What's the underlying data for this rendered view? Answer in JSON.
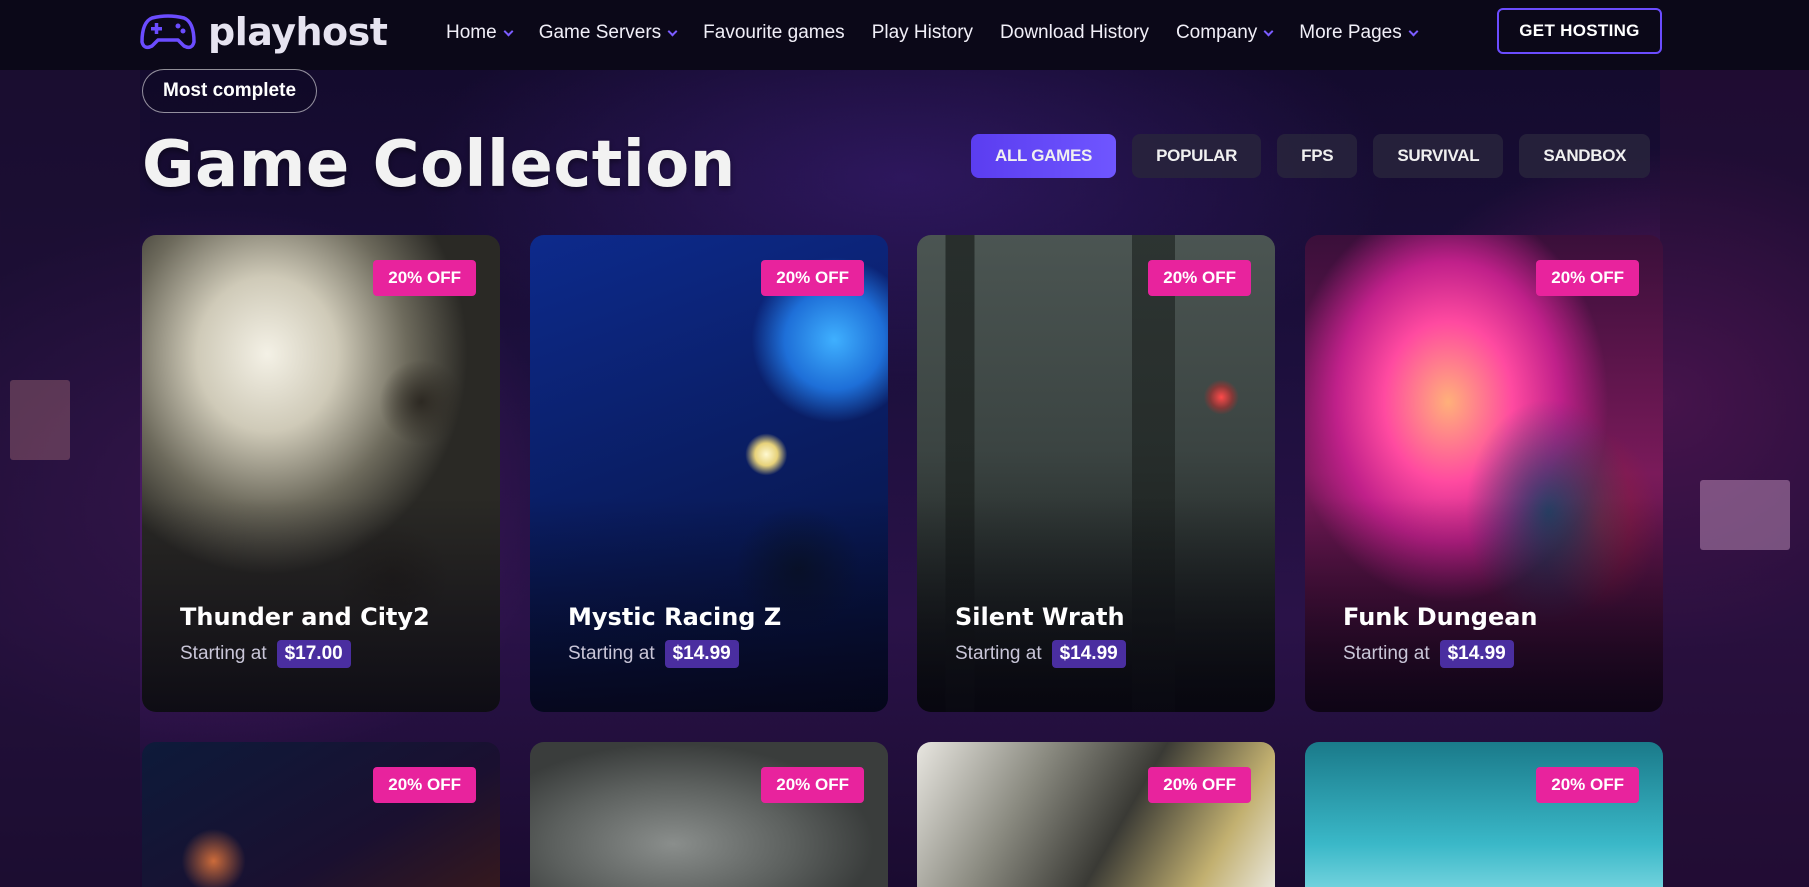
{
  "brand": {
    "name": "playhost"
  },
  "nav": {
    "items": [
      {
        "label": "Home",
        "dropdown": true
      },
      {
        "label": "Game Servers",
        "dropdown": true
      },
      {
        "label": "Favourite games",
        "dropdown": false
      },
      {
        "label": "Play History",
        "dropdown": false
      },
      {
        "label": "Download History",
        "dropdown": false
      },
      {
        "label": "Company",
        "dropdown": true
      },
      {
        "label": "More Pages",
        "dropdown": true
      }
    ],
    "cta_label": "GET HOSTING"
  },
  "hero": {
    "pill": "Most complete",
    "title": "Game Collection"
  },
  "filters": [
    {
      "label": "ALL GAMES",
      "active": true
    },
    {
      "label": "POPULAR",
      "active": false
    },
    {
      "label": "FPS",
      "active": false
    },
    {
      "label": "SURVIVAL",
      "active": false
    },
    {
      "label": "SANDBOX",
      "active": false
    }
  ],
  "games": [
    {
      "title": "Thunder and City2",
      "price_label": "Starting at",
      "price": "$17.00",
      "discount": "20% OFF"
    },
    {
      "title": "Mystic Racing Z",
      "price_label": "Starting at",
      "price": "$14.99",
      "discount": "20% OFF"
    },
    {
      "title": "Silent Wrath",
      "price_label": "Starting at",
      "price": "$14.99",
      "discount": "20% OFF"
    },
    {
      "title": "Funk Dungean",
      "price_label": "Starting at",
      "price": "$14.99",
      "discount": "20% OFF"
    }
  ],
  "games_row2": [
    {
      "discount": "20% OFF"
    },
    {
      "discount": "20% OFF"
    },
    {
      "discount": "20% OFF"
    },
    {
      "discount": "20% OFF"
    }
  ],
  "colors": {
    "accent": "#6b4cff",
    "discount_badge": "#e8239d",
    "price_tag": "#4a2ea0",
    "navbar_bg": "#0b0818"
  }
}
